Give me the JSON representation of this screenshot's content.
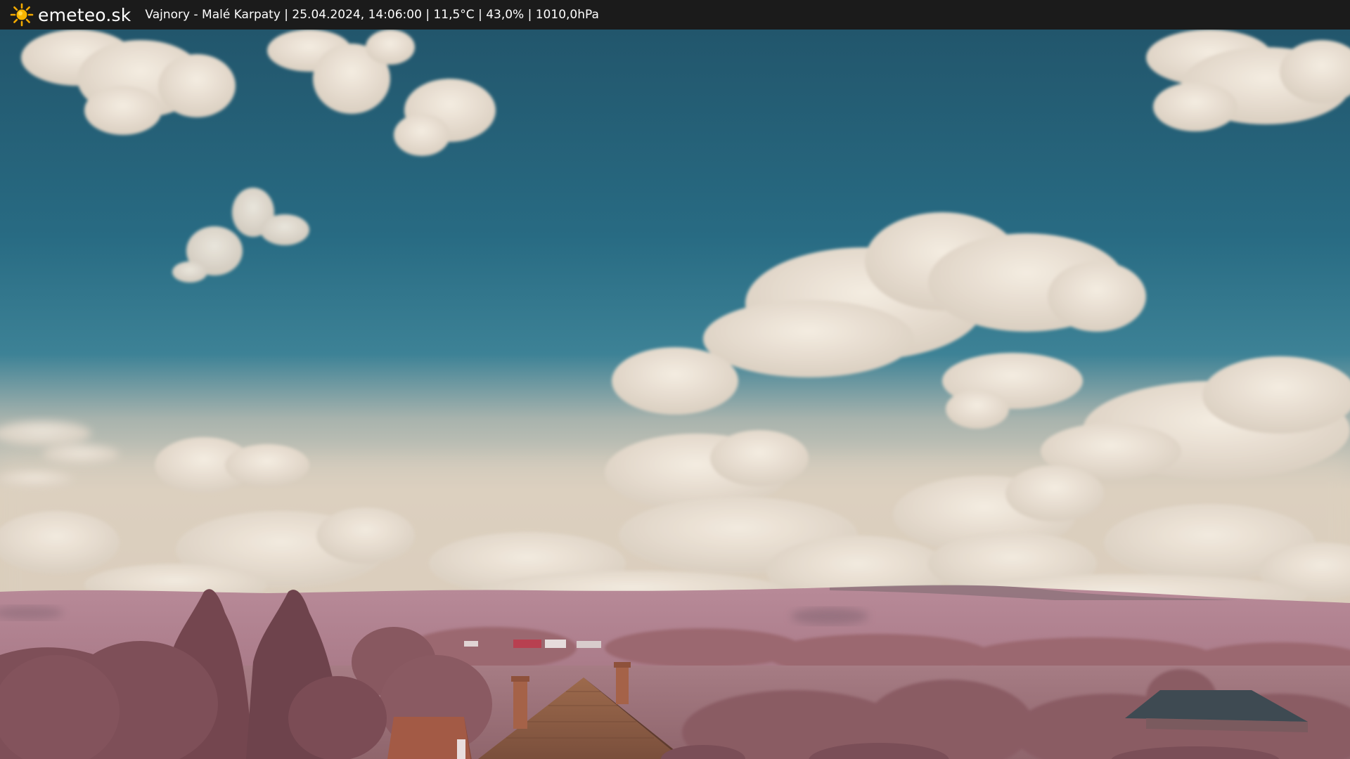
{
  "header": {
    "brand": "emeteo.sk",
    "info_line": "Vajnory - Malé Karpaty | 25.04.2024, 14:06:00 | 11,5°C | 43,0% | 1010,0hPa",
    "logo_icon": "sun-icon"
  },
  "colors": {
    "bar_bg": "#1b1b1b",
    "sky_top": "#235a70",
    "sky_mid": "#2b7088",
    "sky_haze": "#d7cdbf",
    "cloud": "#efe6da",
    "hills": "#b88896",
    "foliage": "#8d5b63",
    "roof": "#a35a45",
    "sun": "#f2a900"
  }
}
